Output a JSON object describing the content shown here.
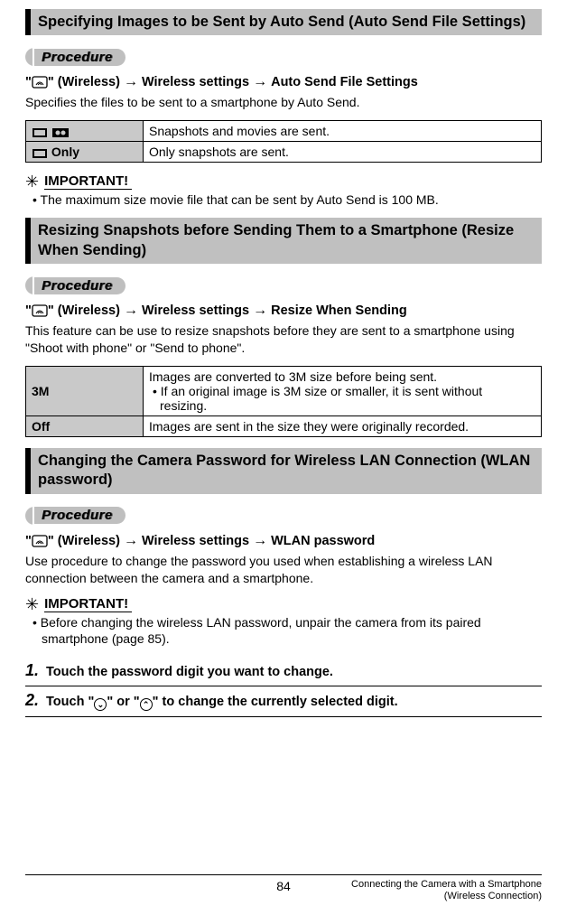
{
  "sections": [
    {
      "title": "Specifying Images to be Sent by Auto Send (Auto Send File Settings)",
      "procedure_label": "Procedure",
      "path": [
        "\" (Wireless)",
        "Wireless settings",
        "Auto Send File Settings"
      ],
      "description": "Specifies the files to be sent to a smartphone by Auto Send.",
      "table": [
        {
          "key_icons": true,
          "key_text": "",
          "value": "Snapshots and movies are sent."
        },
        {
          "key_icons": "only",
          "key_text": " Only",
          "value": "Only snapshots are sent."
        }
      ],
      "important_label": "IMPORTANT!",
      "important_note": "The maximum size movie file that can be sent by Auto Send is 100 MB."
    },
    {
      "title": "Resizing Snapshots before Sending Them to a Smartphone (Resize When Sending)",
      "procedure_label": "Procedure",
      "path": [
        "\" (Wireless)",
        "Wireless settings",
        "Resize When Sending"
      ],
      "description": "This feature can be use to resize snapshots before they are sent to a smartphone using \"Shoot with phone\" or \"Send to phone\".",
      "table": [
        {
          "key_text": "3M",
          "value": "Images are converted to 3M size before being sent.",
          "sub": "If an original image is 3M size or smaller, it is sent without resizing."
        },
        {
          "key_text": "Off",
          "value": "Images are sent in the size they were originally recorded."
        }
      ]
    },
    {
      "title": "Changing the Camera Password for Wireless LAN Connection (WLAN password)",
      "procedure_label": "Procedure",
      "path": [
        "\" (Wireless)",
        "Wireless settings",
        "WLAN password"
      ],
      "description": "Use procedure to change the password you used when establishing a wireless LAN connection between the camera and a smartphone.",
      "important_label": "IMPORTANT!",
      "important_note": "Before changing the wireless LAN password, unpair the camera from its paired smartphone (page 85).",
      "steps": [
        "Touch the password digit you want to change.",
        "Touch \"⌄\" or \"⌃\" to change the currently selected digit."
      ]
    }
  ],
  "footer": {
    "page": "84",
    "right1": "Connecting the Camera with a Smartphone",
    "right2": "(Wireless Connection)"
  }
}
